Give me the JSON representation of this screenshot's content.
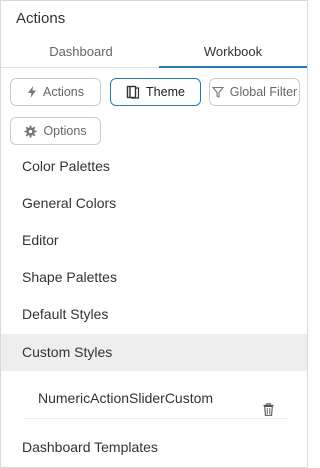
{
  "panel": {
    "title": "Actions"
  },
  "tabs": [
    {
      "label": "Dashboard",
      "active": false
    },
    {
      "label": "Workbook",
      "active": true
    }
  ],
  "toolbar": {
    "actions_label": "Actions",
    "theme_label": "Theme",
    "global_filter_label": "Global Filter",
    "options_label": "Options"
  },
  "menu": {
    "items": [
      "Color Palettes",
      "General Colors",
      "Editor",
      "Shape Palettes",
      "Default Styles",
      "Custom Styles",
      "Dashboard Templates"
    ],
    "active_item": "Custom Styles"
  },
  "custom_styles": {
    "entries": [
      {
        "name": "NumericActionSliderCustom"
      }
    ]
  },
  "colors": {
    "accent": "#2a7ab0",
    "active_row": "#eeeeee",
    "border": "#cccccc"
  },
  "icons": {
    "actions": "lightning-icon",
    "theme": "theme-book-icon",
    "global_filter": "filter-icon",
    "options": "gear-icon",
    "delete": "trash-icon"
  }
}
